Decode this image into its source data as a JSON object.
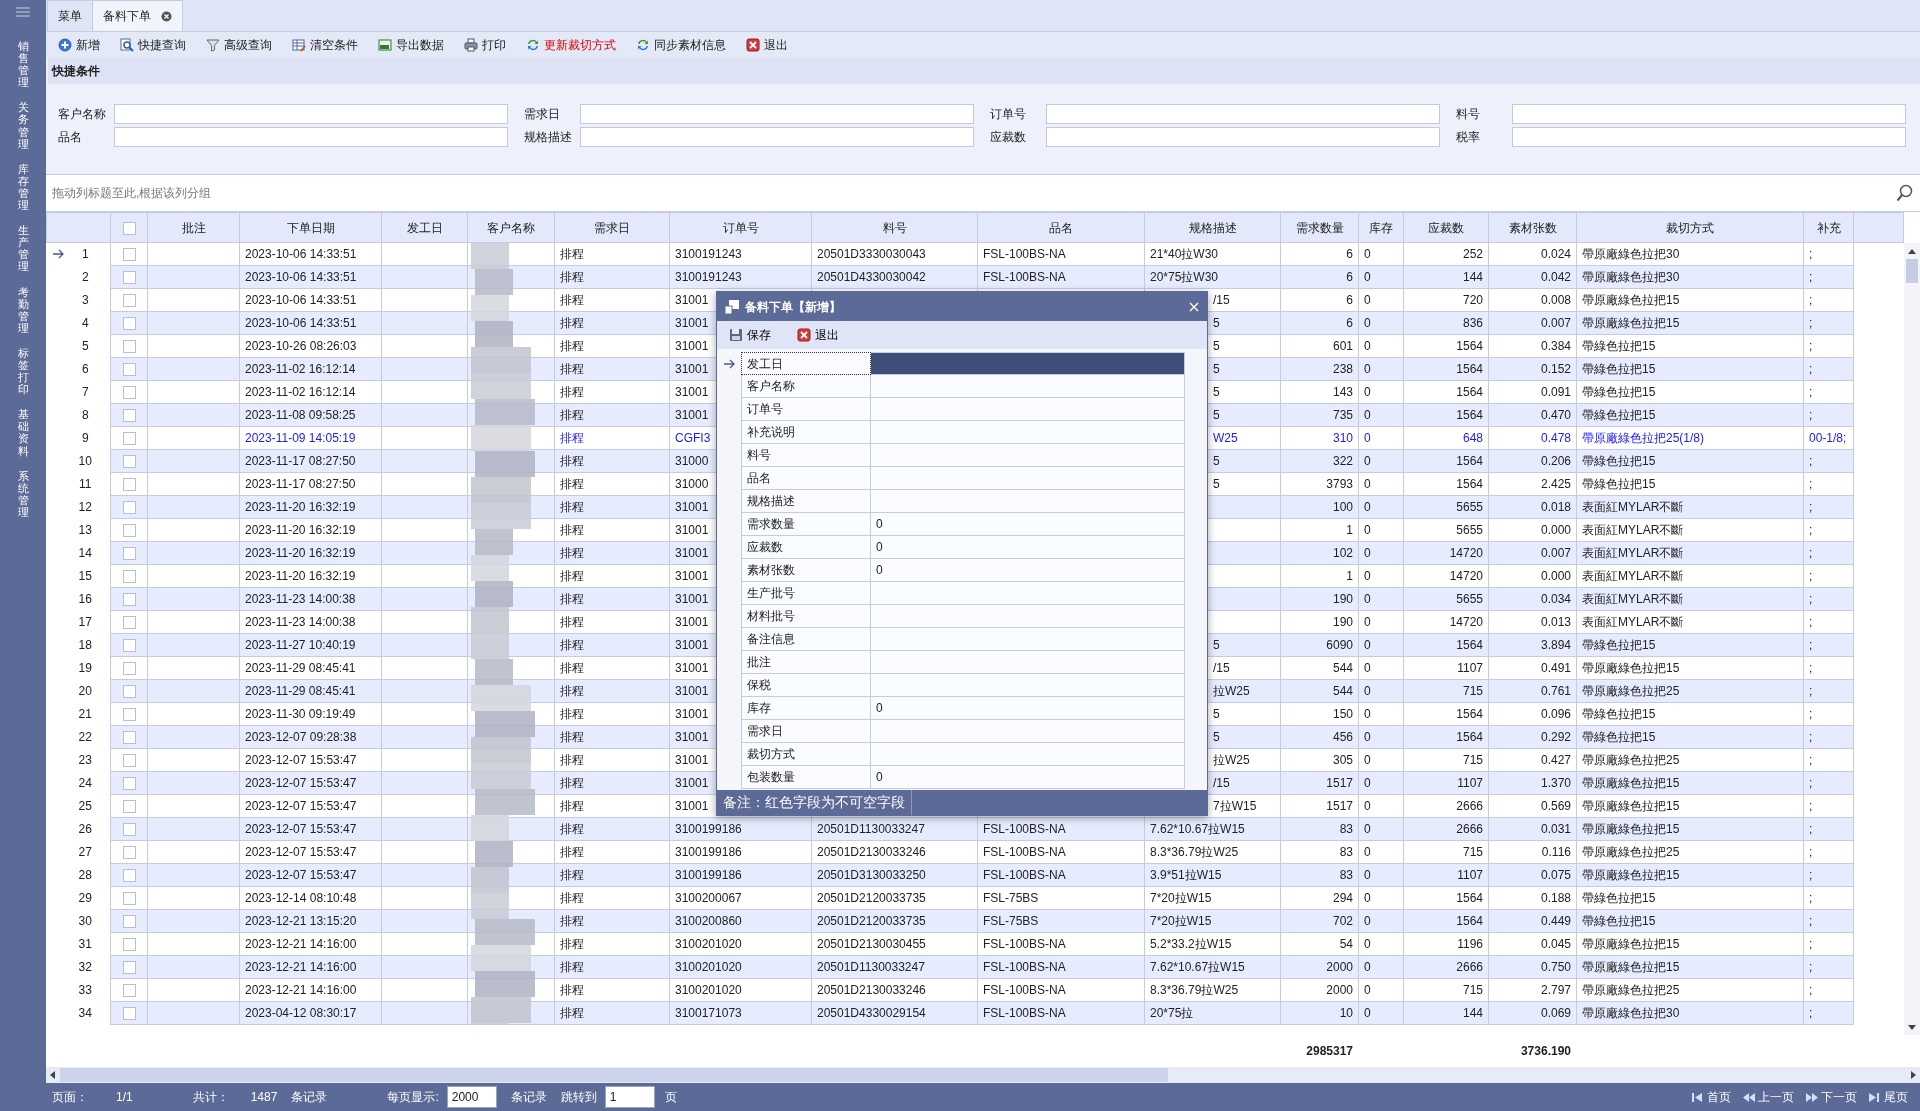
{
  "sidebar": {
    "items": [
      {
        "label": "销售管理"
      },
      {
        "label": "关务管理"
      },
      {
        "label": "库存管理"
      },
      {
        "label": "生产管理"
      },
      {
        "label": "考勤管理"
      },
      {
        "label": "标签打印"
      },
      {
        "label": "基础资料"
      },
      {
        "label": "系统管理"
      }
    ]
  },
  "tabs": [
    {
      "label": "菜单",
      "selected": false,
      "closable": false
    },
    {
      "label": "备料下单",
      "selected": true,
      "closable": true
    }
  ],
  "toolbar": [
    {
      "label": "新增",
      "kind": "normal"
    },
    {
      "label": "快捷查询",
      "kind": "normal"
    },
    {
      "label": "高级查询",
      "kind": "normal"
    },
    {
      "label": "清空条件",
      "kind": "normal"
    },
    {
      "label": "导出数据",
      "kind": "normal"
    },
    {
      "label": "打印",
      "kind": "normal"
    },
    {
      "label": "更新裁切方式",
      "kind": "alert"
    },
    {
      "label": "同步素材信息",
      "kind": "normal"
    },
    {
      "label": "退出",
      "kind": "normal"
    }
  ],
  "quick_filter": {
    "title": "快捷条件",
    "fields": [
      {
        "label": "客户名称"
      },
      {
        "label": "需求日"
      },
      {
        "label": "订单号"
      },
      {
        "label": "料号"
      },
      {
        "label": "品名"
      },
      {
        "label": "规格描述"
      },
      {
        "label": "应裁数"
      },
      {
        "label": "税率"
      }
    ]
  },
  "group_hint": "拖动列标题至此,根据该列分组",
  "table": {
    "select_all_checked": false,
    "columns": [
      "批注",
      "下单日期",
      "发工日",
      "客户名称",
      "需求日",
      "订单号",
      "料号",
      "品名",
      "规格描述",
      "需求数量",
      "库存",
      "应裁数",
      "素材张数",
      "裁切方式",
      "补充"
    ],
    "rows": [
      {
        "no": "1",
        "checked": false,
        "current": true,
        "highlighted": false,
        "date": "2023-10-06 14:33:51",
        "need": "排程",
        "order": "3100191243",
        "part": "20501D3330030043",
        "product": "FSL-100BS-NA",
        "spec": "21*40拉W30",
        "qty": "6",
        "stock": "0",
        "cut": "252",
        "sheets": "0.024",
        "method": "帶原廠綠色拉把30",
        "extra": ";"
      },
      {
        "no": "2",
        "checked": false,
        "current": false,
        "highlighted": false,
        "date": "2023-10-06 14:33:51",
        "need": "排程",
        "order": "3100191243",
        "part": "20501D4330030042",
        "product": "FSL-100BS-NA",
        "spec": "20*75拉W30",
        "qty": "6",
        "stock": "0",
        "cut": "144",
        "sheets": "0.042",
        "method": "帶原廠綠色拉把30",
        "extra": ";"
      },
      {
        "no": "3",
        "checked": false,
        "current": false,
        "highlighted": false,
        "date": "2023-10-06 14:33:51",
        "need": "排程",
        "order": "31001",
        "spec": "/15",
        "qty": "6",
        "stock": "0",
        "cut": "720",
        "sheets": "0.008",
        "method": "帶原廠綠色拉把15",
        "extra": ";"
      },
      {
        "no": "4",
        "checked": false,
        "current": false,
        "highlighted": false,
        "date": "2023-10-06 14:33:51",
        "need": "排程",
        "order": "31001",
        "spec": "5",
        "qty": "6",
        "stock": "0",
        "cut": "836",
        "sheets": "0.007",
        "method": "帶原廠綠色拉把15",
        "extra": ";"
      },
      {
        "no": "5",
        "checked": false,
        "current": false,
        "highlighted": false,
        "date": "2023-10-26 08:26:03",
        "need": "排程",
        "order": "31001",
        "spec": "5",
        "qty": "601",
        "stock": "0",
        "cut": "1564",
        "sheets": "0.384",
        "method": "帶綠色拉把15",
        "extra": ";"
      },
      {
        "no": "6",
        "checked": false,
        "current": false,
        "highlighted": false,
        "date": "2023-11-02 16:12:14",
        "need": "排程",
        "order": "31001",
        "spec": "5",
        "qty": "238",
        "stock": "0",
        "cut": "1564",
        "sheets": "0.152",
        "method": "帶綠色拉把15",
        "extra": ";"
      },
      {
        "no": "7",
        "checked": false,
        "current": false,
        "highlighted": false,
        "date": "2023-11-02 16:12:14",
        "need": "排程",
        "order": "31001",
        "spec": "5",
        "qty": "143",
        "stock": "0",
        "cut": "1564",
        "sheets": "0.091",
        "method": "帶綠色拉把15",
        "extra": ";"
      },
      {
        "no": "8",
        "checked": false,
        "current": false,
        "highlighted": false,
        "date": "2023-11-08 09:58:25",
        "need": "排程",
        "order": "31001",
        "spec": "5",
        "qty": "735",
        "stock": "0",
        "cut": "1564",
        "sheets": "0.470",
        "method": "帶綠色拉把15",
        "extra": ";"
      },
      {
        "no": "9",
        "checked": false,
        "current": false,
        "highlighted": true,
        "date": "2023-11-09 14:05:19",
        "need": "排程",
        "order": "CGFI3",
        "spec": "W25",
        "qty": "310",
        "stock": "0",
        "cut": "648",
        "sheets": "0.478",
        "method": "帶原廠綠色拉把25(1/8)",
        "extra": "00-1/8;"
      },
      {
        "no": "10",
        "checked": false,
        "current": false,
        "highlighted": false,
        "date": "2023-11-17 08:27:50",
        "need": "排程",
        "order": "31000",
        "spec": "5",
        "qty": "322",
        "stock": "0",
        "cut": "1564",
        "sheets": "0.206",
        "method": "帶綠色拉把15",
        "extra": ";"
      },
      {
        "no": "11",
        "checked": false,
        "current": false,
        "highlighted": false,
        "date": "2023-11-17 08:27:50",
        "need": "排程",
        "order": "31000",
        "spec": "5",
        "qty": "3793",
        "stock": "0",
        "cut": "1564",
        "sheets": "2.425",
        "method": "帶綠色拉把15",
        "extra": ";"
      },
      {
        "no": "12",
        "checked": false,
        "current": false,
        "highlighted": false,
        "date": "2023-11-20 16:32:19",
        "need": "排程",
        "order": "31001",
        "qty": "100",
        "stock": "0",
        "cut": "5655",
        "sheets": "0.018",
        "method": "表面紅MYLAR不斷",
        "extra": ";"
      },
      {
        "no": "13",
        "checked": false,
        "current": false,
        "highlighted": false,
        "date": "2023-11-20 16:32:19",
        "need": "排程",
        "order": "31001",
        "qty": "1",
        "stock": "0",
        "cut": "5655",
        "sheets": "0.000",
        "method": "表面紅MYLAR不斷",
        "extra": ";"
      },
      {
        "no": "14",
        "checked": false,
        "current": false,
        "highlighted": false,
        "date": "2023-11-20 16:32:19",
        "need": "排程",
        "order": "31001",
        "qty": "102",
        "stock": "0",
        "cut": "14720",
        "sheets": "0.007",
        "method": "表面紅MYLAR不斷",
        "extra": ";"
      },
      {
        "no": "15",
        "checked": false,
        "current": false,
        "highlighted": false,
        "date": "2023-11-20 16:32:19",
        "need": "排程",
        "order": "31001",
        "qty": "1",
        "stock": "0",
        "cut": "14720",
        "sheets": "0.000",
        "method": "表面紅MYLAR不斷",
        "extra": ";"
      },
      {
        "no": "16",
        "checked": false,
        "current": false,
        "highlighted": false,
        "date": "2023-11-23 14:00:38",
        "need": "排程",
        "order": "31001",
        "qty": "190",
        "stock": "0",
        "cut": "5655",
        "sheets": "0.034",
        "method": "表面紅MYLAR不斷",
        "extra": ";"
      },
      {
        "no": "17",
        "checked": false,
        "current": false,
        "highlighted": false,
        "date": "2023-11-23 14:00:38",
        "need": "排程",
        "order": "31001",
        "qty": "190",
        "stock": "0",
        "cut": "14720",
        "sheets": "0.013",
        "method": "表面紅MYLAR不斷",
        "extra": ";"
      },
      {
        "no": "18",
        "checked": false,
        "current": false,
        "highlighted": false,
        "date": "2023-11-27 10:40:19",
        "need": "排程",
        "order": "31001",
        "spec": "5",
        "qty": "6090",
        "stock": "0",
        "cut": "1564",
        "sheets": "3.894",
        "method": "帶綠色拉把15",
        "extra": ";"
      },
      {
        "no": "19",
        "checked": false,
        "current": false,
        "highlighted": false,
        "date": "2023-11-29 08:45:41",
        "need": "排程",
        "order": "31001",
        "spec": "/15",
        "qty": "544",
        "stock": "0",
        "cut": "1107",
        "sheets": "0.491",
        "method": "帶原廠綠色拉把15",
        "extra": ";"
      },
      {
        "no": "20",
        "checked": false,
        "current": false,
        "highlighted": false,
        "date": "2023-11-29 08:45:41",
        "need": "排程",
        "order": "31001",
        "spec": "拉W25",
        "qty": "544",
        "stock": "0",
        "cut": "715",
        "sheets": "0.761",
        "method": "帶原廠綠色拉把25",
        "extra": ";"
      },
      {
        "no": "21",
        "checked": false,
        "current": false,
        "highlighted": false,
        "date": "2023-11-30 09:19:49",
        "need": "排程",
        "order": "31001",
        "spec": "5",
        "qty": "150",
        "stock": "0",
        "cut": "1564",
        "sheets": "0.096",
        "method": "帶綠色拉把15",
        "extra": ";"
      },
      {
        "no": "22",
        "checked": false,
        "current": false,
        "highlighted": false,
        "date": "2023-12-07 09:28:38",
        "need": "排程",
        "order": "31001",
        "spec": "5",
        "qty": "456",
        "stock": "0",
        "cut": "1564",
        "sheets": "0.292",
        "method": "帶綠色拉把15",
        "extra": ";"
      },
      {
        "no": "23",
        "checked": false,
        "current": false,
        "highlighted": false,
        "date": "2023-12-07 15:53:47",
        "need": "排程",
        "order": "31001",
        "spec": "拉W25",
        "qty": "305",
        "stock": "0",
        "cut": "715",
        "sheets": "0.427",
        "method": "帶原廠綠色拉把25",
        "extra": ";"
      },
      {
        "no": "24",
        "checked": false,
        "current": false,
        "highlighted": false,
        "date": "2023-12-07 15:53:47",
        "need": "排程",
        "order": "31001",
        "spec": "/15",
        "qty": "1517",
        "stock": "0",
        "cut": "1107",
        "sheets": "1.370",
        "method": "帶原廠綠色拉把15",
        "extra": ";"
      },
      {
        "no": "25",
        "checked": false,
        "current": false,
        "highlighted": false,
        "date": "2023-12-07 15:53:47",
        "need": "排程",
        "order": "31001",
        "spec": "7拉W15",
        "qty": "1517",
        "stock": "0",
        "cut": "2666",
        "sheets": "0.569",
        "method": "帶原廠綠色拉把15",
        "extra": ";"
      },
      {
        "no": "26",
        "checked": false,
        "current": false,
        "highlighted": false,
        "date": "2023-12-07 15:53:47",
        "need": "排程",
        "order": "3100199186",
        "part": "20501D1130033247",
        "product": "FSL-100BS-NA",
        "spec": "7.62*10.67拉W15",
        "qty": "83",
        "stock": "0",
        "cut": "2666",
        "sheets": "0.031",
        "method": "帶原廠綠色拉把15",
        "extra": ";"
      },
      {
        "no": "27",
        "checked": false,
        "current": false,
        "highlighted": false,
        "date": "2023-12-07 15:53:47",
        "need": "排程",
        "order": "3100199186",
        "part": "20501D2130033246",
        "product": "FSL-100BS-NA",
        "spec": "8.3*36.79拉W25",
        "qty": "83",
        "stock": "0",
        "cut": "715",
        "sheets": "0.116",
        "method": "帶原廠綠色拉把25",
        "extra": ";"
      },
      {
        "no": "28",
        "checked": false,
        "current": false,
        "highlighted": false,
        "date": "2023-12-07 15:53:47",
        "need": "排程",
        "order": "3100199186",
        "part": "20501D3130033250",
        "product": "FSL-100BS-NA",
        "spec": "3.9*51拉W15",
        "qty": "83",
        "stock": "0",
        "cut": "1107",
        "sheets": "0.075",
        "method": "帶原廠綠色拉把15",
        "extra": ";"
      },
      {
        "no": "29",
        "checked": false,
        "current": false,
        "highlighted": false,
        "date": "2023-12-14 08:10:48",
        "need": "排程",
        "order": "3100200067",
        "part": "20501D2120033735",
        "product": "FSL-75BS",
        "spec": "7*20拉W15",
        "qty": "294",
        "stock": "0",
        "cut": "1564",
        "sheets": "0.188",
        "method": "帶綠色拉把15",
        "extra": ";"
      },
      {
        "no": "30",
        "checked": false,
        "current": false,
        "highlighted": false,
        "date": "2023-12-21 13:15:20",
        "need": "排程",
        "order": "3100200860",
        "part": "20501D2120033735",
        "product": "FSL-75BS",
        "spec": "7*20拉W15",
        "qty": "702",
        "stock": "0",
        "cut": "1564",
        "sheets": "0.449",
        "method": "帶綠色拉把15",
        "extra": ";"
      },
      {
        "no": "31",
        "checked": false,
        "current": false,
        "highlighted": false,
        "date": "2023-12-21 14:16:00",
        "need": "排程",
        "order": "3100201020",
        "part": "20501D2130030455",
        "product": "FSL-100BS-NA",
        "spec": "5.2*33.2拉W15",
        "qty": "54",
        "stock": "0",
        "cut": "1196",
        "sheets": "0.045",
        "method": "帶原廠綠色拉把15",
        "extra": ";"
      },
      {
        "no": "32",
        "checked": false,
        "current": false,
        "highlighted": false,
        "date": "2023-12-21 14:16:00",
        "need": "排程",
        "order": "3100201020",
        "part": "20501D1130033247",
        "product": "FSL-100BS-NA",
        "spec": "7.62*10.67拉W15",
        "qty": "2000",
        "stock": "0",
        "cut": "2666",
        "sheets": "0.750",
        "method": "帶原廠綠色拉把15",
        "extra": ";"
      },
      {
        "no": "33",
        "checked": false,
        "current": false,
        "highlighted": false,
        "date": "2023-12-21 14:16:00",
        "need": "排程",
        "order": "3100201020",
        "part": "20501D2130033246",
        "product": "FSL-100BS-NA",
        "spec": "8.3*36.79拉W25",
        "qty": "2000",
        "stock": "0",
        "cut": "715",
        "sheets": "2.797",
        "method": "帶原廠綠色拉把25",
        "extra": ";"
      },
      {
        "no": "34",
        "checked": false,
        "current": false,
        "highlighted": false,
        "date": "2023-04-12 08:30:17",
        "need": "排程",
        "order": "3100171073",
        "part": "20501D4330029154",
        "product": "FSL-100BS-NA",
        "spec": "20*75拉",
        "qty": "10",
        "stock": "0",
        "cut": "144",
        "sheets": "0.069",
        "method": "帶原廠綠色拉把30",
        "extra": ";"
      }
    ],
    "totals": {
      "qty": "2985317",
      "sheets": "3736.190"
    }
  },
  "dialog": {
    "title": "备料下单【新增】",
    "actions": [
      {
        "label": "保存"
      },
      {
        "label": "退出"
      }
    ],
    "fields": [
      {
        "label": "发工日",
        "selected": true
      },
      {
        "label": "客户名称",
        "selected": false
      },
      {
        "label": "订单号",
        "selected": false
      },
      {
        "label": "补充说明",
        "selected": false
      },
      {
        "label": "料号",
        "selected": false
      },
      {
        "label": "品名",
        "selected": false
      },
      {
        "label": "规格描述",
        "selected": false
      },
      {
        "label": "需求数量",
        "value": "0",
        "selected": false
      },
      {
        "label": "应裁数",
        "value": "0",
        "selected": false
      },
      {
        "label": "素材张数",
        "value": "0",
        "selected": false
      },
      {
        "label": "生产批号",
        "selected": false
      },
      {
        "label": "材料批号",
        "selected": false
      },
      {
        "label": "备注信息",
        "selected": false
      },
      {
        "label": "批注",
        "selected": false
      },
      {
        "label": "保税",
        "selected": false
      },
      {
        "label": "库存",
        "value": "0",
        "selected": false
      },
      {
        "label": "需求日",
        "selected": false
      },
      {
        "label": "裁切方式",
        "selected": false
      },
      {
        "label": "包装数量",
        "value": "0",
        "selected": false
      }
    ],
    "note": "备注：红色字段为不可空字段"
  },
  "pager": {
    "page_label": "页面：",
    "page": "1/1",
    "total_label": "共计：",
    "total": "1487",
    "records_label": "条记录",
    "per_page_label": "每页显示:",
    "per_page": "2000",
    "per_page_suffix": "条记录",
    "goto_label": "跳转到",
    "goto_page": "1",
    "goto_suffix": "页",
    "nav": [
      {
        "label": "首页"
      },
      {
        "label": "上一页"
      },
      {
        "label": "下一页"
      },
      {
        "label": "尾页"
      }
    ]
  }
}
